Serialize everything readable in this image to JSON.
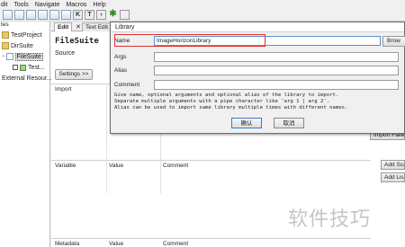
{
  "menu": [
    "dit",
    "Tools",
    "Navigate",
    "Macros",
    "Help"
  ],
  "toolbar": {
    "buttons": [
      "K",
      "T"
    ]
  },
  "tree": {
    "header": "tes",
    "items": [
      {
        "label": "TestProject"
      },
      {
        "label": "DirSuite"
      },
      {
        "label": "FileSuite"
      },
      {
        "label": "Test..."
      },
      {
        "label": "External Resour..."
      }
    ]
  },
  "tabs": [
    {
      "label": "Edit"
    },
    {
      "label": "Text Edit"
    }
  ],
  "editor": {
    "title": "FileSuite",
    "source_label": "Source",
    "settings_button": "Settings >>",
    "sections": {
      "import_header": "Import",
      "variable_table": [
        "Variable",
        "Value",
        "Comment"
      ],
      "metadata_table": [
        "Metadata",
        "Value",
        "Comment"
      ]
    },
    "right_buttons": {
      "import_failed": "Import Failed",
      "add_scalar": "Add Scal",
      "add_list": "Add Lis"
    }
  },
  "dialog": {
    "title": "Library",
    "fields": [
      {
        "label": "Name",
        "value": "ImageHorizonLibrary"
      },
      {
        "label": "Args",
        "value": ""
      },
      {
        "label": "Alias",
        "value": ""
      },
      {
        "label": "Comment",
        "value": ""
      }
    ],
    "browse_button": "Brow",
    "help_lines": [
      "Give name, optional arguments and optional alias of the library to import.",
      "Separate multiple arguments with a pipe character like 'arg 1 | arg 2'.",
      "Alias can be used to import same library multiple times with different names."
    ],
    "ok_button": "确认",
    "cancel_button": "取消"
  },
  "watermark": "软件技巧",
  "colors": {
    "highlight": "#e03030",
    "field_focus": "#5a8fd0"
  }
}
